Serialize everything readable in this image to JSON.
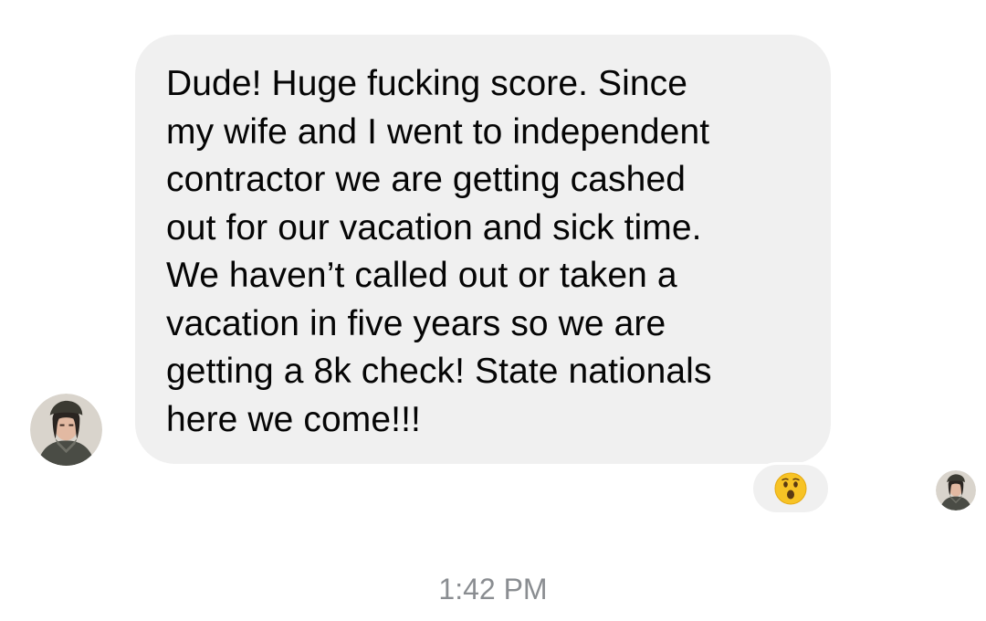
{
  "message": {
    "text": "Dude! Huge fucking score. Since\nmy wife and I went to independent\ncontractor we are getting cashed\nout for our vacation and sick time.\nWe haven’t called out or taken a\nvacation in five years so we are\ngetting a 8k check! State nationals\nhere we come!!!",
    "bubble_color": "#f0f0f0",
    "text_color": "#050505"
  },
  "reaction": {
    "icon": "surprised-face-emoji"
  },
  "sender_avatar": {
    "icon": "profile-photo"
  },
  "read_receipt": {
    "icon": "read-receipt-avatar"
  },
  "timestamp": "1:42 PM",
  "colors": {
    "timestamp": "#8a8d91",
    "background": "#ffffff"
  }
}
